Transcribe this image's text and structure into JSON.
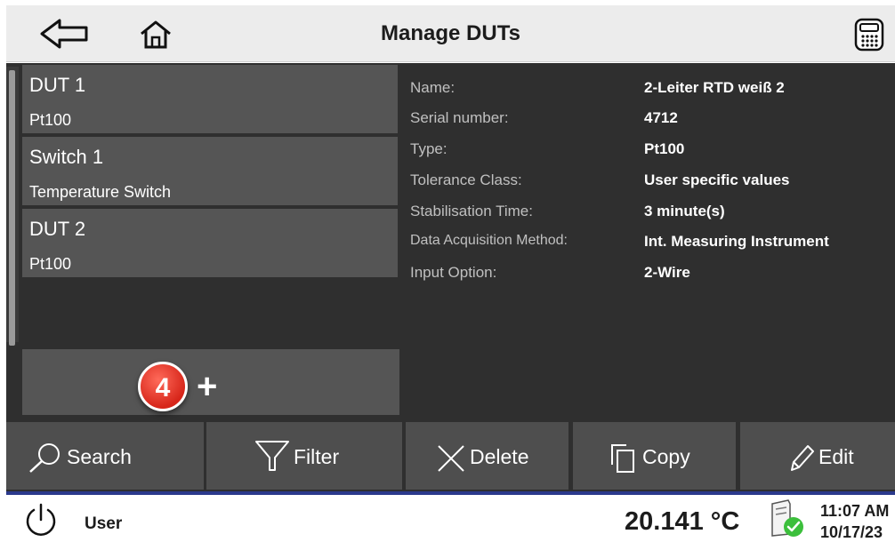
{
  "header": {
    "title": "Manage DUTs",
    "back_icon": "back-arrow-icon",
    "home_icon": "home-icon",
    "calculator_icon": "calculator-icon"
  },
  "dut_list": {
    "items": [
      {
        "name": "DUT 1",
        "type": "Pt100"
      },
      {
        "name": "Switch 1",
        "type": "Temperature Switch"
      },
      {
        "name": "DUT 2",
        "type": "Pt100"
      }
    ],
    "add_badge": "4",
    "add_label": "+"
  },
  "details": [
    {
      "label": "Name:",
      "value": "2-Leiter RTD weiß 2"
    },
    {
      "label": "Serial number:",
      "value": "4712"
    },
    {
      "label": "Type:",
      "value": "Pt100"
    },
    {
      "label": "Tolerance Class:",
      "value": "User specific values"
    },
    {
      "label": "Stabilisation Time:",
      "value": "3 minute(s)"
    },
    {
      "label": "Data Acquisition Method:",
      "value": "Int. Measuring Instrument"
    },
    {
      "label": "Input Option:",
      "value": "2-Wire"
    }
  ],
  "actions": {
    "search": "Search",
    "filter": "Filter",
    "delete": "Delete",
    "copy": "Copy",
    "edit": "Edit"
  },
  "status": {
    "user": "User",
    "temperature": "20.141 °C",
    "time": "11:07 AM",
    "date": "10/17/23"
  },
  "colors": {
    "panel": "#2f2f2f",
    "item": "#555555",
    "accent": "#2b3a8c",
    "badge": "#d7261a"
  }
}
